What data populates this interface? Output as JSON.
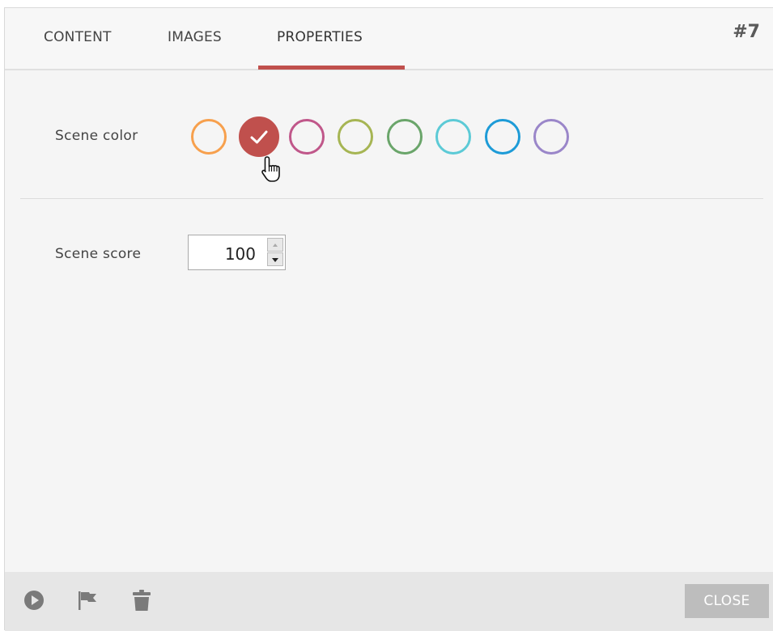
{
  "tabs": [
    {
      "label": "CONTENT"
    },
    {
      "label": "IMAGES"
    },
    {
      "label": "PROPERTIES",
      "active": true
    }
  ],
  "scene_id": "#7",
  "scene_color": {
    "label": "Scene color",
    "options": [
      {
        "color": "#f7a04d",
        "selected": false
      },
      {
        "color": "#c0504d",
        "selected": true
      },
      {
        "color": "#c0578a",
        "selected": false
      },
      {
        "color": "#a6b553",
        "selected": false
      },
      {
        "color": "#6aa56a",
        "selected": false
      },
      {
        "color": "#5ccad6",
        "selected": false
      },
      {
        "color": "#1d9bd7",
        "selected": false
      },
      {
        "color": "#9a86c9",
        "selected": false
      }
    ]
  },
  "scene_score": {
    "label": "Scene score",
    "value": "100"
  },
  "footer": {
    "icons": [
      "play-icon",
      "flag-icon",
      "trash-icon"
    ],
    "close_label": "CLOSE"
  },
  "colors": {
    "accent": "#c0504d",
    "footer_bg": "#e6e6e6",
    "close_button_bg": "#bdbdbd"
  }
}
